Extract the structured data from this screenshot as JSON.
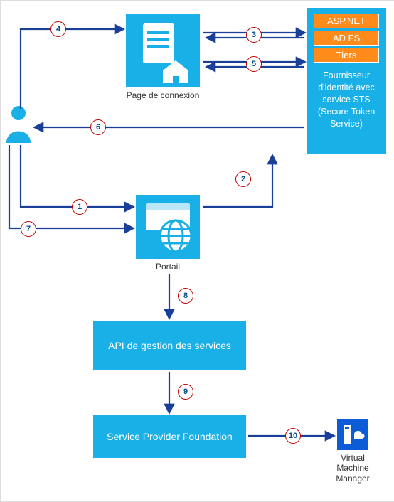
{
  "nodes": {
    "user": "Utilisateur",
    "login_page": "Page de connexion",
    "portal": "Portail",
    "api": "API de gestion des services",
    "spf": "Service Provider Foundation",
    "vmm": "Virtual Machine Manager",
    "idp_caption": "Fournisseur d'identité avec service STS (Secure Token Service)",
    "idp_aspnet": "ASP.NET",
    "idp_adfs": "AD FS",
    "idp_tiers": "Tiers"
  },
  "steps": {
    "s1": "1",
    "s2": "2",
    "s3": "3",
    "s4": "4",
    "s5": "5",
    "s6": "6",
    "s7": "7",
    "s8": "8",
    "s9": "9",
    "s10": "10"
  },
  "colors": {
    "primary": "#19b0e7",
    "arrow": "#1a3f99",
    "step_border": "#c00000",
    "idp_item": "#ff8c1a",
    "vmm": "#0b5cd6"
  }
}
